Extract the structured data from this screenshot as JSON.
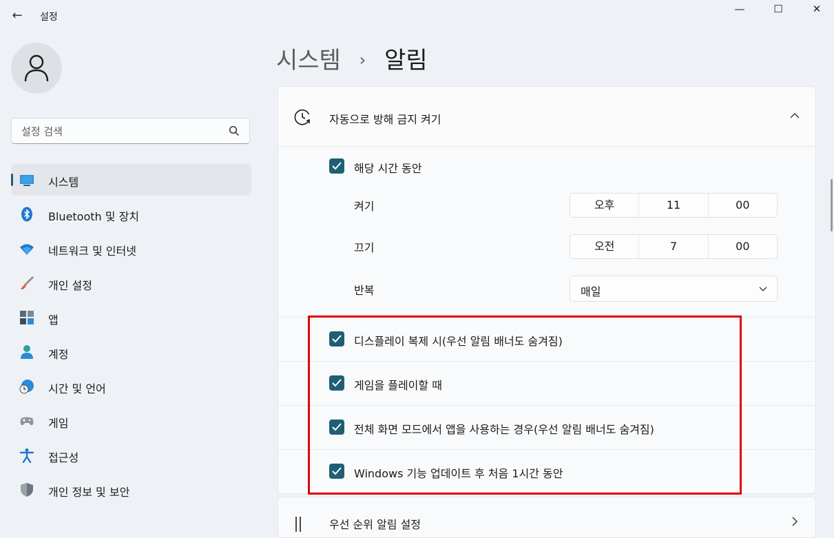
{
  "window": {
    "title": "설정",
    "back_glyph": "←",
    "minimize_glyph": "—",
    "maximize_glyph": "☐",
    "close_glyph": "✕"
  },
  "search": {
    "placeholder": "설정 검색"
  },
  "sidebar": {
    "items": [
      {
        "label": "시스템",
        "icon": "system-icon",
        "active": true
      },
      {
        "label": "Bluetooth 및 장치",
        "icon": "bluetooth-icon"
      },
      {
        "label": "네트워크 및 인터넷",
        "icon": "wifi-icon"
      },
      {
        "label": "개인 설정",
        "icon": "brush-icon"
      },
      {
        "label": "앱",
        "icon": "apps-icon"
      },
      {
        "label": "계정",
        "icon": "account-icon"
      },
      {
        "label": "시간 및 언어",
        "icon": "globe-clock-icon"
      },
      {
        "label": "게임",
        "icon": "gamepad-icon"
      },
      {
        "label": "접근성",
        "icon": "accessibility-icon"
      },
      {
        "label": "개인 정보 및 보안",
        "icon": "shield-icon"
      }
    ]
  },
  "breadcrumb": {
    "parent": "시스템",
    "separator": "›",
    "current": "알림"
  },
  "dnd": {
    "title": "자동으로 방해 금지 켜기",
    "during_hours": {
      "label": "해당 시간 동안",
      "checked": true
    },
    "on_time": {
      "label": "켜기",
      "period": "오후",
      "hour": "11",
      "minute": "00"
    },
    "off_time": {
      "label": "끄기",
      "period": "오전",
      "hour": "7",
      "minute": "00"
    },
    "repeat": {
      "label": "반복",
      "value": "매일"
    },
    "options": [
      {
        "label": "디스플레이 복제 시(우선 알림 배너도 숨겨짐)",
        "checked": true
      },
      {
        "label": "게임을 플레이할 때",
        "checked": true
      },
      {
        "label": "전체 화면 모드에서 앱을 사용하는 경우(우선 알림 배너도 숨겨짐)",
        "checked": true
      },
      {
        "label": "Windows 기능 업데이트 후 처음 1시간 동안",
        "checked": true
      }
    ]
  },
  "next_card": {
    "title": "우선 순위 알림 설정"
  },
  "colors": {
    "accent": "#1e5f74",
    "highlight_border": "#e00000",
    "background": "#eef2f7"
  }
}
